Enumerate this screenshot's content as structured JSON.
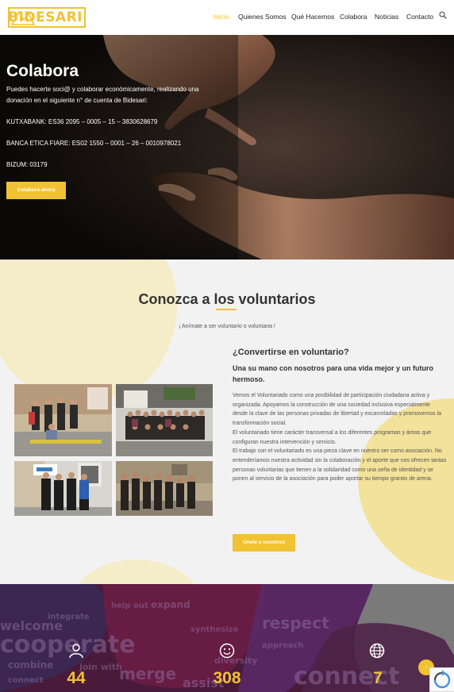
{
  "header": {
    "logo_text": "BIDESARI",
    "nav": [
      {
        "label": "Inicio",
        "active": true
      },
      {
        "label": "Quienes Somos",
        "active": false
      },
      {
        "label": "Qué Hacemos",
        "active": false
      },
      {
        "label": "Colabora",
        "active": false
      },
      {
        "label": "Noticias",
        "active": false
      },
      {
        "label": "Contacto",
        "active": false
      }
    ],
    "search_icon": "search-icon"
  },
  "hero": {
    "title": "Colabora",
    "intro": "Puedes hacerte soci@ y colaborar económicamente, realizando una donación en el siguiente n° de cuenta de Bidesari:",
    "kutxabank": "KUTXABANK: ES36 2095 – 0005 – 15 – 3830628679",
    "banca_etica": "BANCA ETICA FIARE: ES02 1550 – 0001 – 26 – 0010978021",
    "bizum": "BIZUM: 03179",
    "button": "Colabora ahora"
  },
  "volunteers": {
    "title_pre": "Conozca a ",
    "title_highlight": "los",
    "title_post": " voluntarios",
    "subtitle": "¡ Anímate a ser voluntario o voluntaria !",
    "heading": "¿Convertirse en voluntario?",
    "subheading": "Una su mano con nosotros para una vida mejor y un futuro hermoso.",
    "p1": "Vemos el Voluntariado como una posibilidad de participación ciudadana activa y organizada. Apoyamos la construcción de una sociedad inclusiva especialmente desde la clave de las personas privadas de libertad y excarceladas y promovemos la transformación social.",
    "p2": "El voluntariado tiene carácter transversal a los diferentes programas y áreas que configuran nuestra intervención y servicio.",
    "p3": "El trabajo con el voluntariado es una pieza clave en nuestro ser como asociación. No entenderíamos nuestra actividad sin la colaboración y el aporte que nos ofrecen tantas personas voluntarias que tienen a la solidaridad como una seña de identidad y se ponen al servicio de la asociación para poder aportar su tiempo granito de arena.",
    "button": "Únete a nosotros"
  },
  "stats": {
    "items": [
      {
        "icon": "user-icon",
        "value": "44"
      },
      {
        "icon": "smile-icon",
        "value": "308"
      },
      {
        "icon": "globe-icon",
        "value": "7"
      }
    ]
  },
  "scroll_top": "↑",
  "colors": {
    "accent": "#f1c232",
    "dark_text": "#333333",
    "stats_bg": "#5e2043"
  }
}
